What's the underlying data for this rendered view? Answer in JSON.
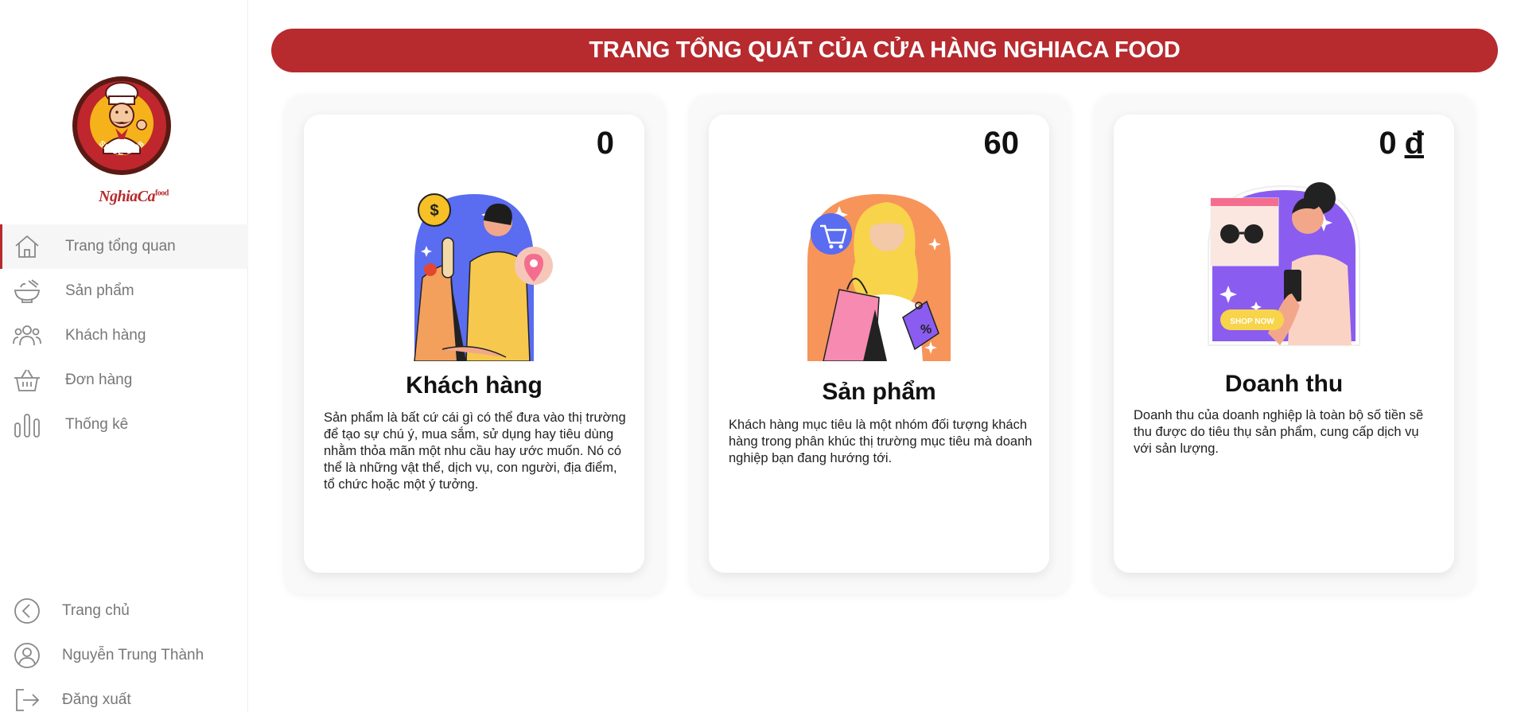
{
  "brand": {
    "name": "NghiaCa",
    "suffix": "food",
    "logo_ring_text": "SINCE 1998"
  },
  "sidebar": {
    "items": [
      {
        "label": "Trang tổng quan",
        "icon": "home-icon",
        "active": true
      },
      {
        "label": "Sản phẩm",
        "icon": "bowl-icon",
        "active": false
      },
      {
        "label": "Khách hàng",
        "icon": "users-icon",
        "active": false
      },
      {
        "label": "Đơn hàng",
        "icon": "basket-icon",
        "active": false
      },
      {
        "label": "Thống kê",
        "icon": "bar-chart-icon",
        "active": false
      }
    ],
    "bottom_items": [
      {
        "label": "Trang chủ",
        "icon": "chevron-left-circle-icon"
      },
      {
        "label": "Nguyễn Trung Thành",
        "icon": "user-circle-icon"
      },
      {
        "label": "Đăng xuất",
        "icon": "logout-icon"
      }
    ]
  },
  "header": {
    "title": "TRANG TỔNG QUÁT CỦA CỬA HÀNG NGHIACA FOOD"
  },
  "cards": [
    {
      "value": "0",
      "title": "Khách hàng",
      "description": "Sản phẩm là bất cứ cái gì có thể đưa vào thị trường để tạo sự chú ý, mua sắm, sử dụng hay tiêu dùng nhằm thỏa mãn một nhu cầu hay ước muốn. Nó có thể là những vật thể, dịch vụ, con người, địa điểm, tổ chức hoặc một ý tưởng.",
      "illustration": "shopper-with-bag-illustration"
    },
    {
      "value": "60",
      "title": "Sản phẩm",
      "description": "Khách hàng mục tiêu là một nhóm đối tượng khách hàng trong phân khúc thị trường mục tiêu mà doanh nghiệp bạn đang hướng tới.",
      "illustration": "woman-shopping-bags-illustration"
    },
    {
      "value": "0",
      "currency": "đ",
      "title": "Doanh thu",
      "description": "Doanh thu của doanh nghiệp là toàn bộ số tiền sẽ thu được do tiêu thụ sản phẩm, cung cấp dịch vụ với sản lượng.",
      "illustration": "online-shop-phone-illustration",
      "illustration_button": "SHOP NOW"
    }
  ],
  "colors": {
    "accent": "#b72a2e",
    "sidebar_text": "#777777",
    "card_bg": "#ffffff"
  }
}
